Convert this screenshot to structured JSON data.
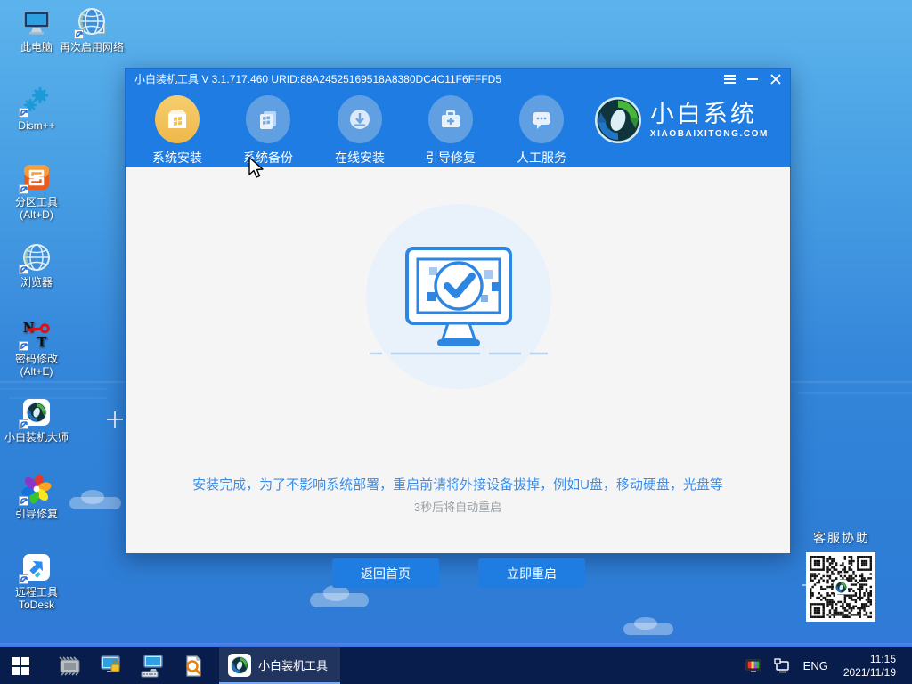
{
  "desktop": {
    "icons": [
      {
        "name": "this-pc",
        "label": "此电脑",
        "sub": ""
      },
      {
        "name": "enable-network",
        "label": "再次启用网络",
        "sub": ""
      },
      {
        "name": "dism",
        "label": "Dism++",
        "sub": ""
      },
      {
        "name": "partition-tool",
        "label": "分区工具",
        "sub": "(Alt+D)"
      },
      {
        "name": "browser",
        "label": "浏览器",
        "sub": ""
      },
      {
        "name": "password-change",
        "label": "密码修改",
        "sub": "(Alt+E)"
      },
      {
        "name": "xiaobai-master",
        "label": "小白装机大师",
        "sub": ""
      },
      {
        "name": "boot-repair",
        "label": "引导修复",
        "sub": ""
      },
      {
        "name": "todesk",
        "label": "远程工具",
        "sub": "ToDesk"
      }
    ]
  },
  "window": {
    "title": "小白装机工具 V 3.1.717.460 URID:88A24525169518A8380DC4C11F6FFFD5",
    "nav": [
      {
        "label": "系统安装",
        "icon": "install-icon",
        "active": true
      },
      {
        "label": "系统备份",
        "icon": "backup-icon",
        "active": false
      },
      {
        "label": "在线安装",
        "icon": "download-icon",
        "active": false
      },
      {
        "label": "引导修复",
        "icon": "repair-icon",
        "active": false
      },
      {
        "label": "人工服务",
        "icon": "service-icon",
        "active": false
      }
    ],
    "logo": {
      "title": "小白系统",
      "subtitle": "XIAOBAIXITONG.COM"
    },
    "content": {
      "message": "安装完成，为了不影响系统部署，重启前请将外接设备拔掉，例如U盘，移动硬盘，光盘等",
      "countdown": "3秒后将自动重启",
      "buttons": {
        "home": "返回首页",
        "restart": "立即重启"
      }
    }
  },
  "qr": {
    "label": "客服协助"
  },
  "taskbar": {
    "active_task": "小白装机工具",
    "lang": "ENG",
    "time": "11:15",
    "date": "2021/11/19"
  },
  "colors": {
    "header_blue": "#1e7ce2",
    "content_bg": "#f5f5f6",
    "accent_blue": "#2f86e0",
    "button_blue": "#1f7de2",
    "message_blue": "#3b8de8",
    "active_icon_yellow": "#f0c35c",
    "taskbar_navy": "#081d4b",
    "desktop_top": "#5cb3ec",
    "desktop_bottom": "#2e7cd5"
  }
}
